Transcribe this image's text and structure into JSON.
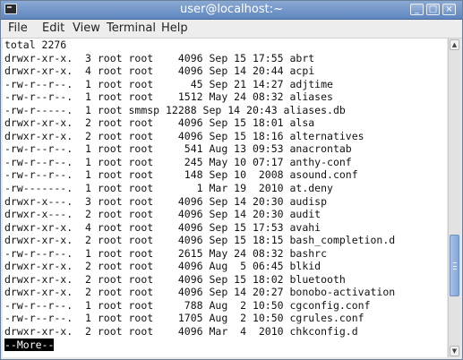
{
  "window": {
    "title": "user@localhost:~",
    "buttons": {
      "minimize": "_",
      "maximize": "□",
      "close": "×"
    }
  },
  "menubar": {
    "items": [
      "File",
      "Edit",
      "View",
      "Terminal",
      "Help"
    ]
  },
  "terminal": {
    "header": "total 2276",
    "lines": [
      "drwxr-xr-x.  3 root root    4096 Sep 15 17:55 abrt",
      "drwxr-xr-x.  4 root root    4096 Sep 14 20:44 acpi",
      "-rw-r--r--.  1 root root      45 Sep 21 14:27 adjtime",
      "-rw-r--r--.  1 root root    1512 May 24 08:32 aliases",
      "-rw-r-----.  1 root smmsp 12288 Sep 14 20:43 aliases.db",
      "drwxr-xr-x.  2 root root    4096 Sep 15 18:01 alsa",
      "drwxr-xr-x.  2 root root    4096 Sep 15 18:16 alternatives",
      "-rw-r--r--.  1 root root     541 Aug 13 09:53 anacrontab",
      "-rw-r--r--.  1 root root     245 May 10 07:17 anthy-conf",
      "-rw-r--r--.  1 root root     148 Sep 10  2008 asound.conf",
      "-rw-------.  1 root root       1 Mar 19  2010 at.deny",
      "drwxr-x---.  3 root root    4096 Sep 14 20:30 audisp",
      "drwxr-x---.  2 root root    4096 Sep 14 20:30 audit",
      "drwxr-xr-x.  4 root root    4096 Sep 15 17:53 avahi",
      "drwxr-xr-x.  2 root root    4096 Sep 15 18:15 bash_completion.d",
      "-rw-r--r--.  1 root root    2615 May 24 08:32 bashrc",
      "drwxr-xr-x.  2 root root    4096 Aug  5 06:45 blkid",
      "drwxr-xr-x.  2 root root    4096 Sep 15 18:02 bluetooth",
      "drwxr-xr-x.  2 root root    4096 Sep 14 20:27 bonobo-activation",
      "-rw-r--r--.  1 root root     788 Aug  2 10:50 cgconfig.conf",
      "-rw-r--r--.  1 root root    1705 Aug  2 10:50 cgrules.conf",
      "drwxr-xr-x.  2 root root    4096 Mar  4  2010 chkconfig.d"
    ],
    "pager_prompt": "--More--"
  },
  "scrollbar": {
    "position": 0.79,
    "visible_fraction": 0.21
  }
}
